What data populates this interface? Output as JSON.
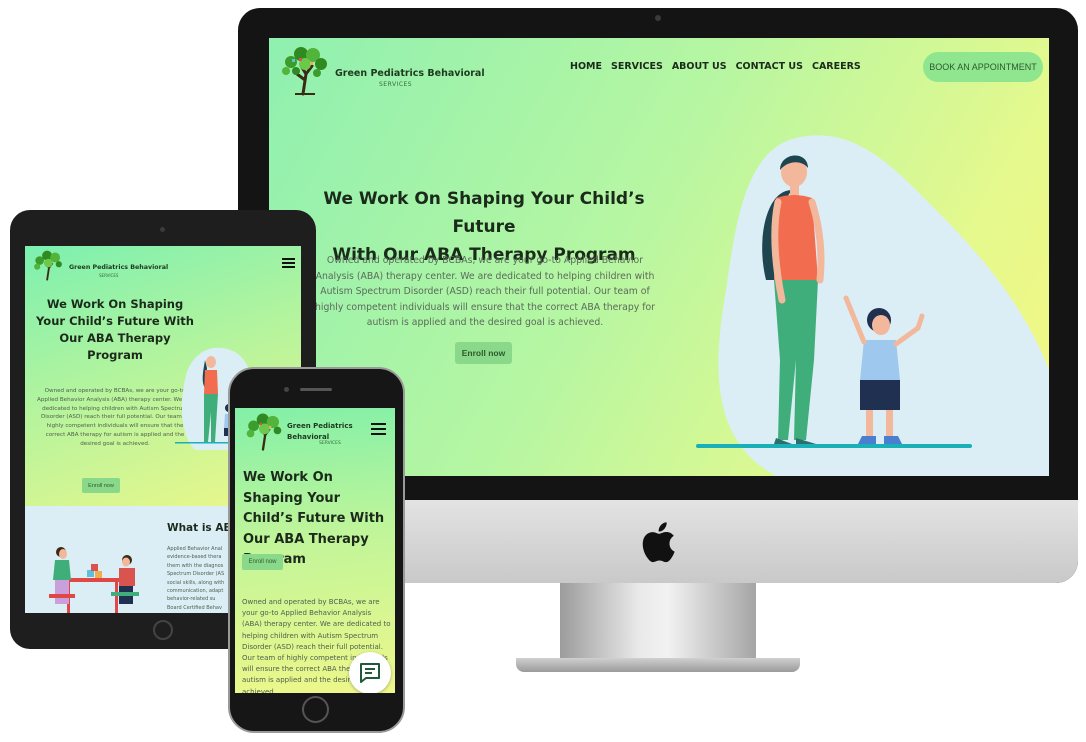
{
  "brand": {
    "name": "Green Pediatrics Behavioral",
    "sub": "SERVICES"
  },
  "nav": {
    "items": [
      "HOME",
      "SERVICES",
      "ABOUT US",
      "CONTACT US",
      "CAREERS"
    ],
    "book_label": "BOOK AN APPOINTMENT"
  },
  "hero": {
    "title_line1": "We Work On Shaping Your Child’s Future",
    "title_line2": "With Our ABA Therapy Program",
    "title_tablet": "We Work On Shaping Your Child’s Future With Our ABA Therapy Program",
    "body_desktop": "Owned and operated by BCBAs, we are your go-to Applied Behavior Analysis (ABA) therapy center. We are dedicated to helping children with Autism Spectrum Disorder (ASD) reach their full potential. Our team of highly competent individuals will ensure that the correct ABA therapy for autism is applied and the desired goal is achieved.",
    "body_tablet": "Owned and operated by BCBAs, we are your go-to Applied Behavior Analysis (ABA) therapy center. We are dedicated to helping children with Autism Spectrum Disorder (ASD) reach their full potential. Our team of highly competent individuals will ensure that the correct ABA therapy for autism is applied and the desired goal is achieved.",
    "body_phone": "Owned and operated by BCBAs, we are your go-to Applied Behavior Analysis (ABA) therapy center. We are dedicated to helping children with Autism Spectrum Disorder (ASD) reach their full potential. Our team of highly competent individuals will ensure the correct ABA therapy for autism is applied and the desired goal is achieved.",
    "enroll_label": "Enroll now"
  },
  "tablet_section": {
    "heading": "What is ABA",
    "body": "Applied Behavior Anal\nevidence-based thera\nthem with the diagnos\nSpectrum Disorder (AS\nsocial skills, along with\ncommunication, adapt\nbehavior-related su\nBoard Certified Behav"
  },
  "colors": {
    "accent_green": "#8ad98a",
    "gradient_start": "#8ff0b0",
    "gradient_end": "#f4f782",
    "blob": "#dbeef5"
  },
  "icons": [
    "tree-logo-icon",
    "hamburger-menu-icon",
    "chat-icon",
    "apple-logo-icon"
  ]
}
